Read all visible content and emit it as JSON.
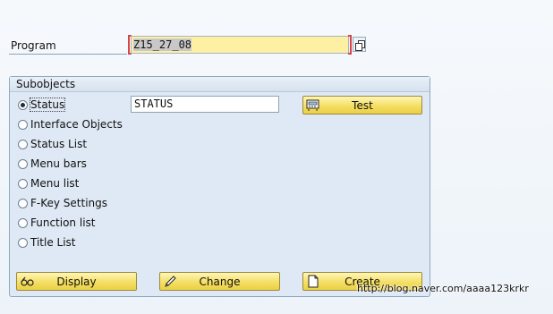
{
  "program": {
    "label": "Program",
    "value": "Z15_27_08"
  },
  "subobjects": {
    "title": "Subobjects",
    "selected": 0,
    "options": [
      {
        "label": "Status"
      },
      {
        "label": "Interface Objects"
      },
      {
        "label": "Status List"
      },
      {
        "label": "Menu bars"
      },
      {
        "label": "Menu list"
      },
      {
        "label": "F-Key Settings"
      },
      {
        "label": "Function list"
      },
      {
        "label": "Title List"
      }
    ],
    "status_value": "STATUS"
  },
  "buttons": {
    "test": "Test",
    "display": "Display",
    "change": "Change",
    "create": "Create"
  },
  "icons": {
    "copy": "copy-icon",
    "test": "test-icon",
    "display": "glasses-icon",
    "change": "pencil-icon",
    "create": "new-document-icon"
  },
  "colors": {
    "field_highlight": "#fdf0a2",
    "button_yellow": "#f4df64",
    "required_bracket": "#d94545",
    "group_background": "#dfe9f5"
  },
  "watermark": "http://blog.naver.com/aaaa123krkr"
}
